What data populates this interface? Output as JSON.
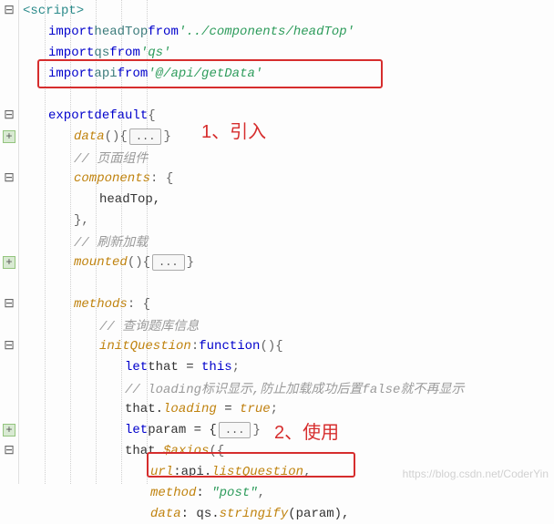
{
  "gutter_marks": [
    "minus",
    "",
    "",
    "",
    "",
    "minus",
    "plus",
    "",
    "minus",
    "",
    "",
    "",
    "plus",
    "",
    "minus",
    "",
    "minus",
    "",
    "",
    "",
    "",
    "plus",
    "minus",
    ""
  ],
  "lines": {
    "l0": {
      "indent": 0
    },
    "l1": {
      "indent": 1,
      "a": "import",
      "b": "headTop",
      "c": "from",
      "d": "'../components/headTop'"
    },
    "l2": {
      "indent": 1,
      "a": "import",
      "b": "qs",
      "c": "from",
      "d": "'qs'"
    },
    "l3": {
      "indent": 1,
      "a": "import",
      "b": "api",
      "c": "from",
      "d": "'@/api/getData'"
    },
    "l5": {
      "indent": 1,
      "a": "export",
      "b": "default",
      "c": "{"
    },
    "l6": {
      "indent": 2,
      "a": "data",
      "b": "()",
      "c": "{",
      "d": "...",
      "e": "}"
    },
    "l7": {
      "indent": 2,
      "a": "// 页面组件"
    },
    "l8": {
      "indent": 2,
      "a": "components",
      "b": ": {"
    },
    "l9": {
      "indent": 3,
      "a": "headTop,"
    },
    "l10": {
      "indent": 2,
      "a": "},"
    },
    "l11": {
      "indent": 2,
      "a": "// 刷新加载"
    },
    "l12": {
      "indent": 2,
      "a": "mounted",
      "b": "(){",
      "c": "...",
      "d": "}"
    },
    "l14": {
      "indent": 2,
      "a": "methods",
      "b": ": {"
    },
    "l15": {
      "indent": 3,
      "a": "// 查询题库信息"
    },
    "l16": {
      "indent": 3,
      "a": "initQuestion",
      "b": ":",
      "c": "function",
      "d": "(){"
    },
    "l17": {
      "indent": 4,
      "a": "let",
      "b": "that = ",
      "c": "this",
      "d": ";"
    },
    "l18": {
      "indent": 4,
      "a": "// loading标识显示,防止加载成功后置false就不再显示"
    },
    "l19": {
      "indent": 4,
      "a": "that.",
      "b": "loading",
      "c": " = ",
      "d": "true",
      "e": ";"
    },
    "l20": {
      "indent": 4,
      "a": "let",
      "b": "param = {",
      "c": "...",
      "d": "}"
    },
    "l21": {
      "indent": 4,
      "a": "that.",
      "b": "$axios",
      "c": "({"
    },
    "l22": {
      "indent": 5,
      "a": "url",
      "b": ":api.",
      "c": "listQuestion",
      "d": ","
    },
    "l23": {
      "indent": 5,
      "a": "method",
      "b": ": ",
      "c": "\"post\"",
      "d": ","
    },
    "l24": {
      "indent": 5,
      "a": "data",
      "b": ": qs.",
      "c": "stringify",
      "d": "(param),"
    }
  },
  "tag_open": "<script>",
  "annot1": "1、引入",
  "annot2": "2、使用",
  "watermark": "https://blog.csdn.net/CoderYin",
  "fold": "..."
}
